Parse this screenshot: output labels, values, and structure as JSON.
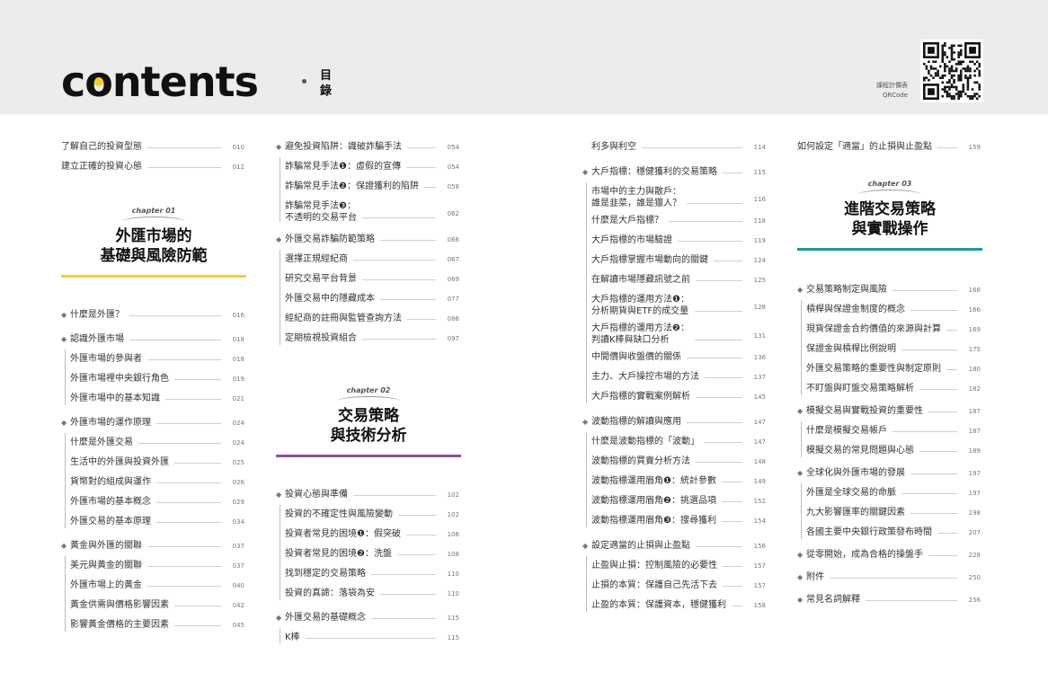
{
  "header": {
    "brand_pre": "c",
    "brand_o": "o",
    "brand_post": "ntents",
    "brand_sub": "目錄",
    "qr_label_1": "課程計價表",
    "qr_label_2": "QRCode"
  },
  "colors": {
    "yellow": "#f2d024",
    "purple": "#8a4f9e",
    "teal": "#1c9b9a"
  },
  "col1": {
    "intro": [
      {
        "text": "了解自己的投資型態",
        "page": "010"
      },
      {
        "text": "建立正確的投資心態",
        "page": "012"
      }
    ],
    "chapter": {
      "label": "chapter 01",
      "title_1": "外匯市場的",
      "title_2": "基礎與風險防範"
    },
    "items": [
      {
        "text": "什麼是外匯？",
        "page": "016",
        "top": true
      },
      {
        "text": "認識外匯市場",
        "page": "018",
        "top": true
      },
      {
        "text": "外匯市場的參與者",
        "page": "018"
      },
      {
        "text": "外匯市場裡中央銀行角色",
        "page": "019"
      },
      {
        "text": "外匯市場中的基本知識",
        "page": "021"
      },
      {
        "text": "外匯市場的運作原理",
        "page": "024",
        "top": true
      },
      {
        "text": "什麼是外匯交易",
        "page": "024"
      },
      {
        "text": "生活中的外匯與投資外匯",
        "page": "025"
      },
      {
        "text": "貨幣對的組成與運作",
        "page": "026"
      },
      {
        "text": "外匯市場的基本概念",
        "page": "029"
      },
      {
        "text": "外匯交易的基本原理",
        "page": "034"
      },
      {
        "text": "黃金與外匯的關聯",
        "page": "037",
        "top": true
      },
      {
        "text": "美元與黃金的關聯",
        "page": "037"
      },
      {
        "text": "外匯市場上的黃金",
        "page": "040"
      },
      {
        "text": "黃金供需與價格影響因素",
        "page": "042"
      },
      {
        "text": "影響黃金價格的主要因素",
        "page": "045"
      }
    ]
  },
  "col2": {
    "items_a": [
      {
        "text": "避免投資陷阱：識破詐騙手法",
        "page": "054",
        "top": true
      },
      {
        "text": "詐騙常見手法❶：虛假的宣傳",
        "page": "054"
      },
      {
        "text": "詐騙常見手法❷：保證獲利的陷阱",
        "page": "058"
      },
      {
        "text": "詐騙常見手法❸：\n不透明的交易平台",
        "page": "062",
        "two": true
      },
      {
        "text": "外匯交易詐騙防範策略",
        "page": "066",
        "top": true
      },
      {
        "text": "選擇正規經紀商",
        "page": "067"
      },
      {
        "text": "研究交易平台背景",
        "page": "069"
      },
      {
        "text": "外匯交易中的隱藏成本",
        "page": "077"
      },
      {
        "text": "經紀商的註冊與監管查詢方法",
        "page": "086"
      },
      {
        "text": "定期檢視投資組合",
        "page": "097"
      }
    ],
    "chapter": {
      "label": "chapter 02",
      "title_1": "交易策略",
      "title_2": "與技術分析"
    },
    "items_b": [
      {
        "text": "投資心態與準備",
        "page": "102",
        "top": true
      },
      {
        "text": "投資的不確定性與風險變動",
        "page": "102"
      },
      {
        "text": "投資者常見的困境❶：假突破",
        "page": "106"
      },
      {
        "text": "投資者常見的困境❷：洗盤",
        "page": "108"
      },
      {
        "text": "找到穩定的交易策略",
        "page": "110"
      },
      {
        "text": "投資的真諦：落袋為安",
        "page": "110"
      },
      {
        "text": "外匯交易的基礎概念",
        "page": "115",
        "top": true
      },
      {
        "text": "K棒",
        "page": "115"
      }
    ]
  },
  "col3": {
    "items": [
      {
        "text": "利多與利空",
        "page": "114"
      },
      {
        "text": "大戶指標：穩健獲利的交易策略",
        "page": "115",
        "top": true
      },
      {
        "text": "市場中的主力與散戶：\n誰是韭菜，誰是獵人？",
        "page": "116",
        "two": true
      },
      {
        "text": "什麼是大戶指標？",
        "page": "118"
      },
      {
        "text": "大戶指標的市場驗證",
        "page": "119"
      },
      {
        "text": "大戶指標掌握市場動向的關鍵",
        "page": "124"
      },
      {
        "text": "在解讀市場隱藏訊號之前",
        "page": "125"
      },
      {
        "text": "大戶指標的運用方法❶：\n分析期貨與ETF的成交量",
        "page": "128",
        "two": true
      },
      {
        "text": "大戶指標的運用方法❷：\n判讀K棒與缺口分析",
        "page": "131",
        "two": true
      },
      {
        "text": "中間價與收盤價的關係",
        "page": "136"
      },
      {
        "text": "主力、大戶操控市場的方法",
        "page": "137"
      },
      {
        "text": "大戶指標的實戰案例解析",
        "page": "145"
      },
      {
        "text": "波動指標的解讀與應用",
        "page": "147",
        "top": true
      },
      {
        "text": "什麼是波動指標的「波動」",
        "page": "147"
      },
      {
        "text": "波動指標的買賣分析方法",
        "page": "148"
      },
      {
        "text": "波動指標運用眉角❶：統計參數",
        "page": "149"
      },
      {
        "text": "波動指標運用眉角❷：挑選品項",
        "page": "152"
      },
      {
        "text": "波動指標運用眉角❸：搜尋獲利",
        "page": "154"
      },
      {
        "text": "設定適當的止損與止盈點",
        "page": "156",
        "top": true
      },
      {
        "text": "止盈與止損：控制風險的必要性",
        "page": "157"
      },
      {
        "text": "止損的本質：保護自己先活下去",
        "page": "157"
      },
      {
        "text": "止盈的本質：保護資本，穩健獲利",
        "page": "158"
      }
    ]
  },
  "col4": {
    "intro": [
      {
        "text": "如何設定「適當」的止損與止盈點",
        "page": "159"
      }
    ],
    "chapter": {
      "label": "chapter 03",
      "title_1": "進階交易策略",
      "title_2": "與實戰操作"
    },
    "items": [
      {
        "text": "交易策略制定與風險",
        "page": "166",
        "top": true
      },
      {
        "text": "槓桿與保證金制度的概念",
        "page": "166"
      },
      {
        "text": "現貨保證金合約價值的來源與計算",
        "page": "169"
      },
      {
        "text": "保證金與槓桿比例說明",
        "page": "175"
      },
      {
        "text": "外匯交易策略的重要性與制定原則",
        "page": "180"
      },
      {
        "text": "不盯盤與盯盤交易策略解析",
        "page": "182"
      },
      {
        "text": "模擬交易與實戰投資的重要性",
        "page": "187",
        "top": true
      },
      {
        "text": "什麼是模擬交易帳戶",
        "page": "187"
      },
      {
        "text": "模擬交易的常見問題與心態",
        "page": "189"
      },
      {
        "text": "全球化與外匯市場的發展",
        "page": "197",
        "top": true
      },
      {
        "text": "外匯是全球交易的命脈",
        "page": "197"
      },
      {
        "text": "九大影響匯率的關鍵因素",
        "page": "198"
      },
      {
        "text": "各國主要中央銀行政策發布時間",
        "page": "207"
      },
      {
        "text": "從零開始，成為合格的操盤手",
        "page": "228",
        "top": true
      },
      {
        "text": "附件",
        "page": "250",
        "top": true
      },
      {
        "text": "常見名詞解釋",
        "page": "256",
        "top": true
      }
    ]
  }
}
